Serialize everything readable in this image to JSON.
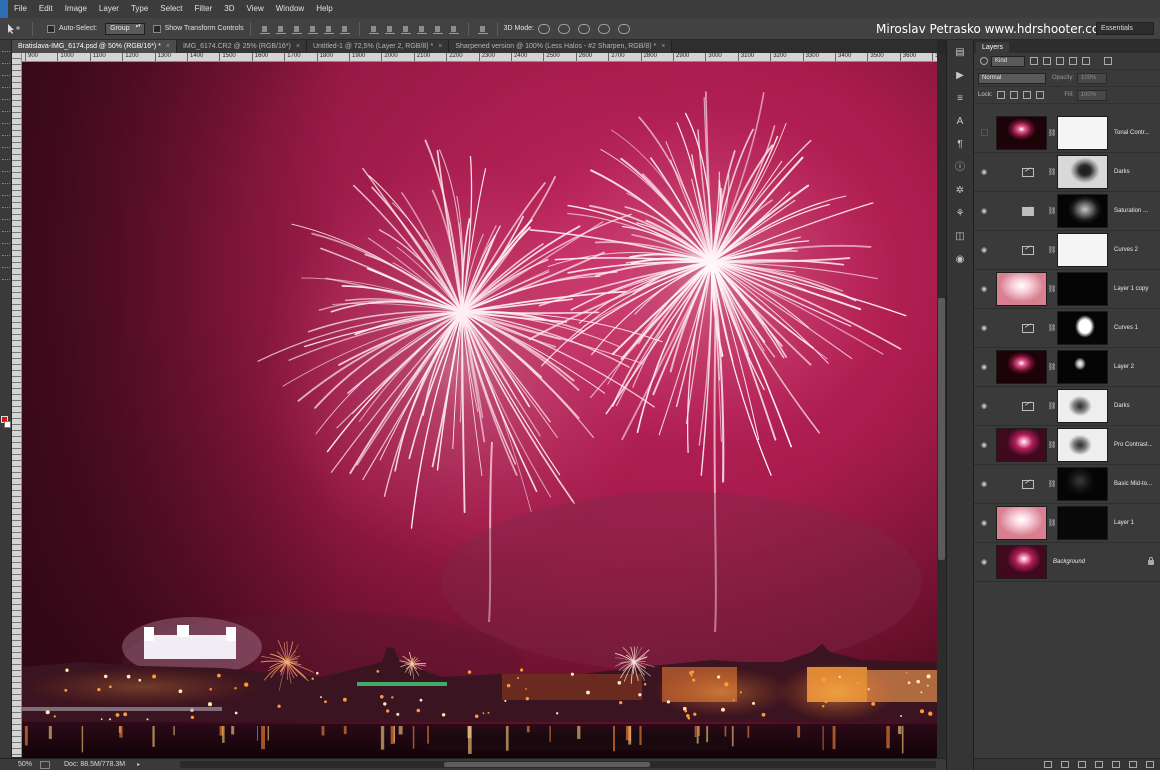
{
  "menu": {
    "items": [
      "File",
      "Edit",
      "Image",
      "Layer",
      "Type",
      "Select",
      "Filter",
      "3D",
      "View",
      "Window",
      "Help"
    ]
  },
  "options_bar": {
    "auto_select_label": "Auto-Select:",
    "auto_select_value": "Group",
    "show_transform_label": "Show Transform Controls",
    "mode_3d_label": "3D Mode:",
    "credit_text": "Miroslav  Petrasko  www.hdrshooter.com",
    "workspace": "Essentials"
  },
  "tabs": [
    {
      "label": "Bratislava-IMG_6174.psd @ 50% (RGB/16*) *",
      "close": "×",
      "active": true
    },
    {
      "label": "IMG_6174.CR2 @ 25% (RGB/16*)",
      "close": "×",
      "active": false
    },
    {
      "label": "Untitled-1 @ 72,5% (Layer 2, RGB/8) *",
      "close": "×",
      "active": false
    },
    {
      "label": "Sharpened version @ 100% (Less Halos - #2 Sharpen, RGB/8) *",
      "close": "×",
      "active": false
    }
  ],
  "ruler": {
    "ticks": [
      "900",
      "1000",
      "1100",
      "1200",
      "1300",
      "1400",
      "1500",
      "1600",
      "1700",
      "1800",
      "1900",
      "2000",
      "2100",
      "2200",
      "2300",
      "2400",
      "2500",
      "2600",
      "2700",
      "2800",
      "2900",
      "3000",
      "3100",
      "3200",
      "3300",
      "3400",
      "3500",
      "3600",
      "370"
    ]
  },
  "status": {
    "zoom": "50%",
    "doc_size": "Doc: 88.5M/778.3M",
    "arrow": "▸"
  },
  "layers_panel": {
    "tab": "Layers",
    "filter_kind": "Kind",
    "blend_mode": "Normal",
    "opacity_label": "Opacity:",
    "opacity_value": "100%",
    "lock_label": "Lock:",
    "fill_label": "Fill:",
    "fill_value": "100%",
    "layers": [
      {
        "name": "Tonal Contr...",
        "visible": false,
        "kind": "photo",
        "thumb": "p-dark",
        "mask": "m-white"
      },
      {
        "name": "Darks",
        "visible": true,
        "kind": "curves",
        "mask": "m-burst"
      },
      {
        "name": "Saturation ...",
        "visible": true,
        "kind": "huesat",
        "mask": "m-burst-dark"
      },
      {
        "name": "Curves 2",
        "visible": true,
        "kind": "curves",
        "mask": "m-white"
      },
      {
        "name": "Layer 1 copy",
        "visible": true,
        "kind": "photo",
        "thumb": "p-pale",
        "mask": "m-black"
      },
      {
        "name": "Curves 1",
        "visible": true,
        "kind": "curves",
        "mask": "m-blob"
      },
      {
        "name": "Layer 2",
        "visible": true,
        "kind": "photo",
        "thumb": "p-dark",
        "mask": "m-spark"
      },
      {
        "name": "Darks",
        "visible": true,
        "kind": "curves",
        "mask": "m-burst-light"
      },
      {
        "name": "Pro Contrast...",
        "visible": true,
        "kind": "photo",
        "thumb": "p-magenta",
        "mask": "m-burst-light"
      },
      {
        "name": "Basic Mid-to...",
        "visible": true,
        "kind": "curves",
        "mask": "m-faint"
      },
      {
        "name": "Layer 1",
        "visible": true,
        "kind": "photo",
        "thumb": "p-pale",
        "mask": "m-faint-dark"
      },
      {
        "name": "Background",
        "visible": true,
        "kind": "background",
        "thumb": "p-magenta",
        "locked": true
      }
    ]
  },
  "icons": {
    "eye": "eye-icon",
    "chain": "chain-link-icon",
    "lock": "lock-icon"
  },
  "colors": {
    "foreground": "#e01010",
    "background": "#ffffff",
    "sky_top": "#c81e5a",
    "sky_dark": "#3c0818"
  }
}
